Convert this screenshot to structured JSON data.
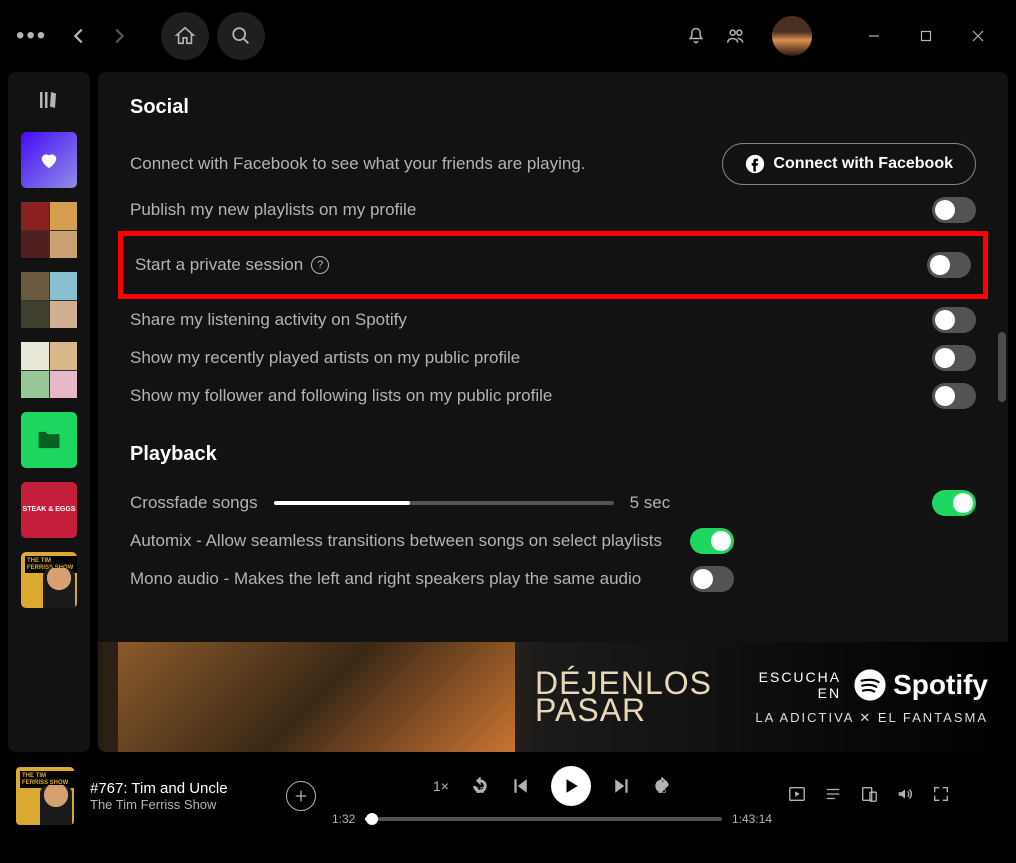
{
  "topbar": {
    "menu": "•••"
  },
  "settings": {
    "social": {
      "title": "Social",
      "connect_desc": "Connect with Facebook to see what your friends are playing.",
      "connect_btn": "Connect with Facebook",
      "items": [
        {
          "label": "Publish my new playlists on my profile",
          "on": false
        },
        {
          "label": "Start a private session",
          "on": false,
          "help": true,
          "highlight": true
        },
        {
          "label": "Share my listening activity on Spotify",
          "on": false
        },
        {
          "label": "Show my recently played artists on my public profile",
          "on": false
        },
        {
          "label": "Show my follower and following lists on my public profile",
          "on": false
        }
      ]
    },
    "playback": {
      "title": "Playback",
      "crossfade_label": "Crossfade songs",
      "crossfade_value": "5 sec",
      "items": [
        {
          "label": "Automix - Allow seamless transitions between songs on select playlists",
          "on": true
        },
        {
          "label": "Mono audio - Makes the left and right speakers play the same audio",
          "on": false
        }
      ],
      "crossfade_on": true
    }
  },
  "ad": {
    "title1": "DÉJENLOS",
    "title2": "PASAR",
    "listen": "ESCUCHA EN",
    "brand": "Spotify",
    "sub": "LA ADICTIVA ✕ EL FANTASMA"
  },
  "player": {
    "title": "#767: Tim and Uncle",
    "artist": "The Tim Ferriss Show",
    "speed": "1×",
    "skip_back": "15",
    "skip_fwd": "15",
    "elapsed": "1:32",
    "total": "1:43:14"
  },
  "sidebar": {
    "steak": "STEAK & EGGS",
    "tim": "THE TIM FERRISS SHOW"
  }
}
